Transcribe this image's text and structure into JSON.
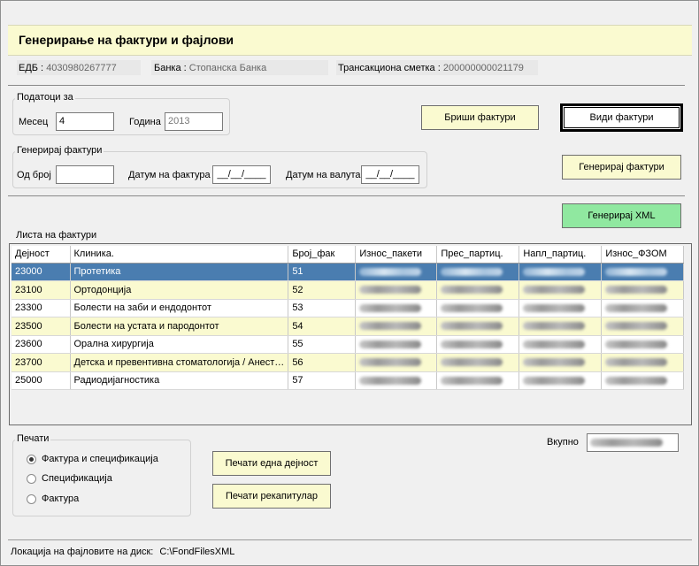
{
  "title": "Генерирање на фактури и фајлови",
  "info": {
    "edb_label": "ЕДБ :",
    "edb_value": "4030980267777",
    "bank_label": "Банка :",
    "bank_value": "Стопанска Банка",
    "account_label": "Трансакциона сметка :",
    "account_value": "200000000021179"
  },
  "data_for": {
    "group_title": "Податоци за",
    "month_label": "Месец",
    "month_value": "4",
    "year_label": "Година",
    "year_value": "2013"
  },
  "generate": {
    "group_title": "Генерирај фактури",
    "from_label": "Од број",
    "from_value": "",
    "invoice_date_label": "Датум на фактура",
    "invoice_date_value": "__/__/____",
    "currency_date_label": "Датум на валута",
    "currency_date_value": "__/__/____"
  },
  "buttons": {
    "delete_invoices": "Бриши фактури",
    "view_invoices": "Види фактури",
    "generate_invoices": "Генерирај фактури",
    "generate_xml": "Генерирај XML",
    "print_one": "Печати една дејност",
    "print_recap": "Печати рекапитулар"
  },
  "list": {
    "title": "Листа на фактури",
    "columns": [
      "Дејност",
      "Клиника.",
      "Број_фак",
      "Износ_пакети",
      "Прес_партиц.",
      "Напл_партиц.",
      "Износ_ФЗОМ"
    ],
    "rows": [
      {
        "code": "23000",
        "clinic": "Протетика",
        "num": "51"
      },
      {
        "code": "23100",
        "clinic": "Ортодонција",
        "num": "52"
      },
      {
        "code": "23300",
        "clinic": "Болести на заби и ендодонтот",
        "num": "53"
      },
      {
        "code": "23500",
        "clinic": "Болести на устата и пародонтот",
        "num": "54"
      },
      {
        "code": "23600",
        "clinic": "Орална хирургија",
        "num": "55"
      },
      {
        "code": "23700",
        "clinic": "Детска и превентивна стоматологија / Анест…",
        "num": "56"
      },
      {
        "code": "25000",
        "clinic": "Радиодијагностика",
        "num": "57"
      }
    ]
  },
  "total_label": "Вкупно",
  "print": {
    "group_title": "Печати",
    "options": [
      "Фактура и спецификација",
      "Спецификација",
      "Фактура"
    ],
    "selected": 0
  },
  "location": {
    "label": "Локација на фајловите на диск:",
    "value": "C:\\FondFilesXML"
  }
}
